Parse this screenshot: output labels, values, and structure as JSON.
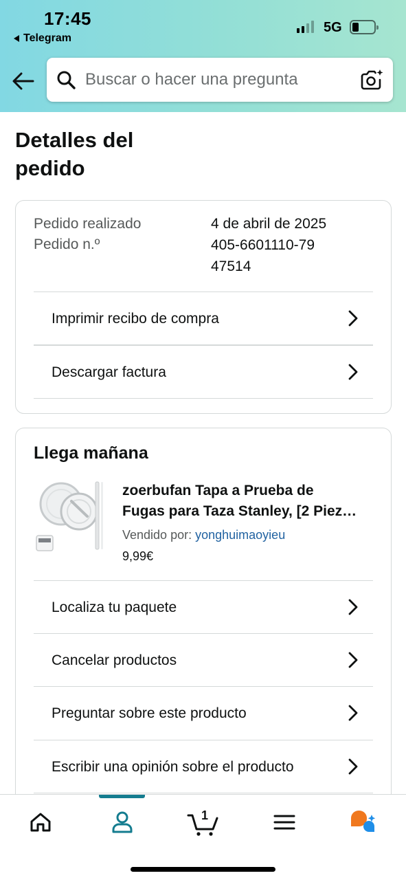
{
  "status_bar": {
    "time": "17:45",
    "back_app": "Telegram",
    "network": "5G",
    "battery_level": 0.2
  },
  "search": {
    "placeholder": "Buscar o hacer una pregunta"
  },
  "page": {
    "title": "Detalles del pedido"
  },
  "order_info": {
    "placed_label": "Pedido realizado",
    "placed_value": "4 de abril de 2025",
    "number_label": "Pedido n.º",
    "number_value": "405-6601110-7947514",
    "actions": [
      {
        "label": "Imprimir recibo de compra"
      },
      {
        "label": "Descargar factura"
      }
    ]
  },
  "shipment": {
    "title": "Llega mañana",
    "product": {
      "title_line1": "zoerbufan Tapa a Prueba de",
      "title_line2": "Fugas para Taza Stanley, [2 Piez…",
      "seller_label": "Vendido por:",
      "seller_name": "yonghuimaoyieu",
      "price": "9,99€"
    },
    "actions": [
      {
        "label": "Localiza tu paquete"
      },
      {
        "label": "Cancelar productos"
      },
      {
        "label": "Preguntar sobre este producto"
      },
      {
        "label": "Escribir una opinión sobre el producto"
      }
    ]
  },
  "bottom_nav": {
    "items": [
      {
        "icon": "home-icon"
      },
      {
        "icon": "account-icon",
        "active": true
      },
      {
        "icon": "cart-icon",
        "badge": "1"
      },
      {
        "icon": "menu-icon"
      },
      {
        "icon": "rufus-assistant-icon"
      }
    ],
    "accent_color": "#147c8f"
  },
  "colors": {
    "header_gradient_start": "#82d8e3",
    "header_gradient_end": "#a6e5d0",
    "link": "#2162a1",
    "secondary_text": "#565959",
    "border": "#d5d9d9",
    "assistant_orange": "#f0781e",
    "assistant_blue": "#1f8ee8"
  }
}
